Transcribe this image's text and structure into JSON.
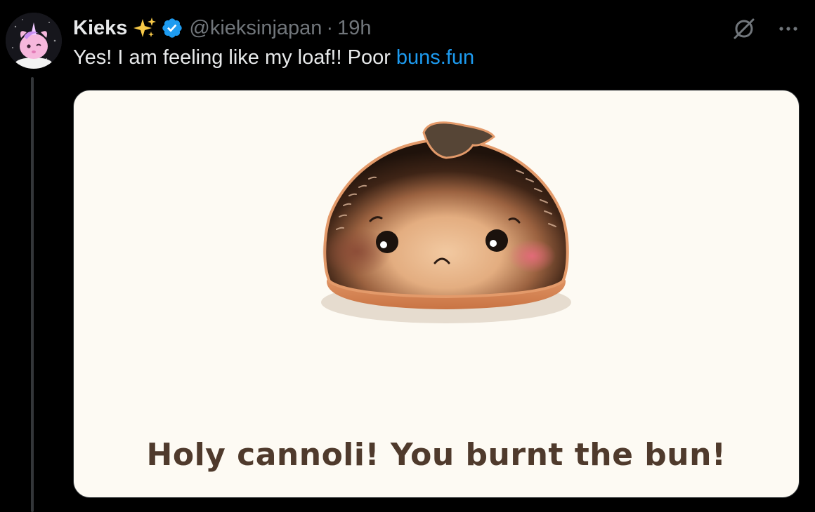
{
  "tweet": {
    "author_name": "Kieks",
    "handle": "@kieksinjapan",
    "separator": "·",
    "time": "19h",
    "text_before_link": "Yes! I am feeling like my loaf!! Poor ",
    "link_text": "buns.fun",
    "icons": {
      "sparkle": "sparkles-emoji-icon",
      "verified": "verified-badge-icon",
      "grok": "grok-icon",
      "more": "more-icon",
      "avatar": "avatar"
    }
  },
  "media": {
    "caption": "Holy cannoli! You burnt the bun!"
  },
  "colors": {
    "background": "#000000",
    "text": "#e7e9ea",
    "secondary": "#71767b",
    "link": "#1d9bf0",
    "media_bg": "#fdfaf3",
    "caption": "#4f3a2c"
  }
}
